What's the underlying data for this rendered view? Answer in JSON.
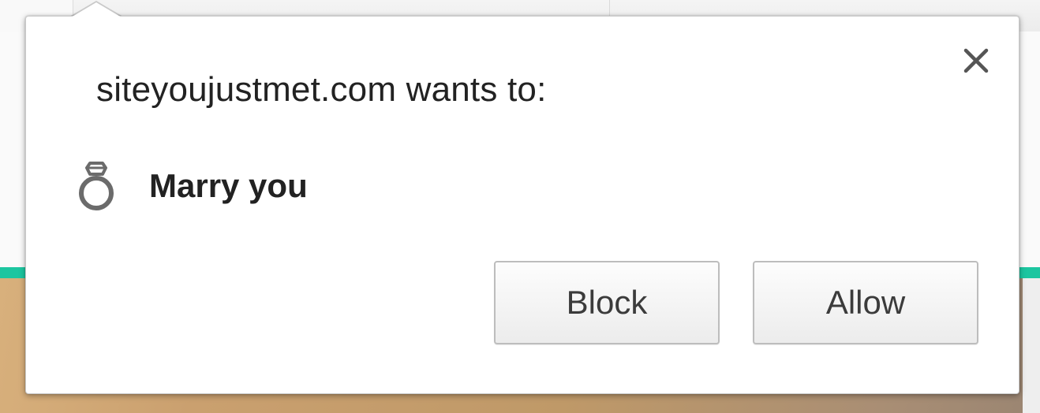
{
  "prompt": {
    "title": "siteyoujustmet.com wants to:",
    "permission_label": "Marry you",
    "permission_icon": "ring-icon",
    "close_icon": "close-icon"
  },
  "buttons": {
    "block_label": "Block",
    "allow_label": "Allow"
  },
  "colors": {
    "accent_bar": "#1cc6a0",
    "text": "#222222",
    "button_text": "#3b3b3b"
  }
}
